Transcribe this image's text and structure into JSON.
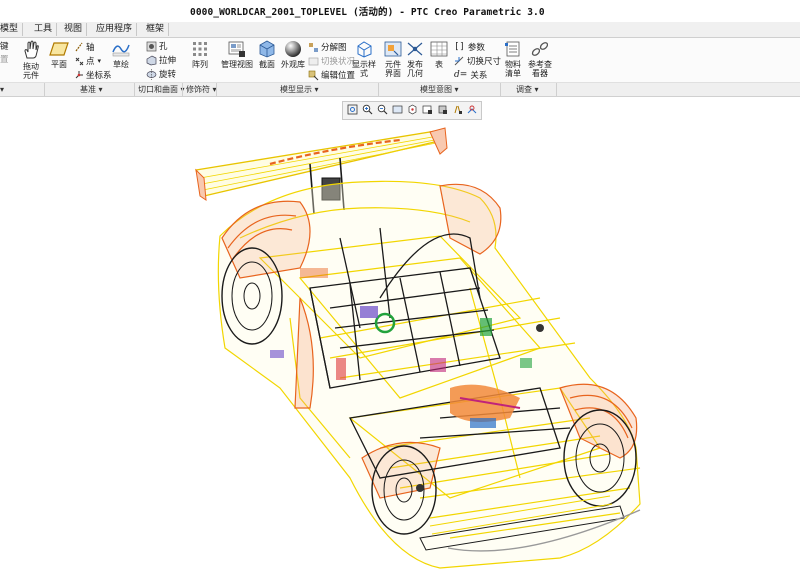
{
  "window": {
    "title": "0000_WORLDCAR_2001_TOPLEVEL (活动的) - PTC Creo Parametric 3.0"
  },
  "tabs": [
    "模型",
    "工具",
    "视图",
    "应用程序",
    "框架"
  ],
  "ribbon": {
    "left_partial": [
      "键",
      "置"
    ],
    "drag_components": "拖动\n元件",
    "plane": "平面",
    "axis": "轴",
    "point": "点",
    "coord_sys": "坐标系",
    "sketch": "草绘",
    "hole": "孔",
    "extrude": "拉伸",
    "revolve": "旋转",
    "pattern": "阵列",
    "manage_views": "管理视图",
    "section": "截面",
    "appearance_lib": "外观库",
    "exploded_view": "分解图",
    "toggle_status": "切换状况",
    "edit_position": "编辑位置",
    "display_style": "显示样\n式",
    "component_interface": "元件\n界面",
    "publish_geometry": "发布\n几何",
    "table": "表",
    "parameters": "参数",
    "toggle_dimensions": "切换尺寸",
    "relations": "关系",
    "bill_of_materials": "物料\n清单",
    "reference_viewer": "参考查\n看器"
  },
  "groups": {
    "datum": "基准",
    "cut_surface": "切口和曲面",
    "modifiers": "修饰符",
    "model_display": "模型显示",
    "model_intent": "模型意图",
    "investigate": "调查"
  },
  "view_toolbar_icons": [
    "refit-icon",
    "zoom-in-icon",
    "zoom-out-icon",
    "repaint-icon",
    "spin-center-icon",
    "named-views-icon",
    "display-style-icon",
    "datum-display-icon",
    "annotation-display-icon"
  ],
  "colors": {
    "wire_yellow": "#f2d600",
    "wire_orange": "#e8641e",
    "wire_black": "#1a1a1a",
    "ribbon_bg": "#fbfbfb"
  }
}
